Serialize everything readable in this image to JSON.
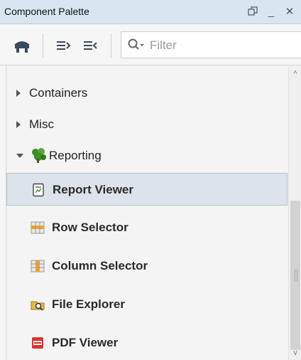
{
  "window": {
    "title": "Component Palette",
    "controls": {
      "restore_icon": "restore-icon",
      "minimize_glyph": "_",
      "close_glyph": "✕"
    }
  },
  "toolbar": {
    "tools": [
      {
        "name": "palette-mode-icon"
      },
      {
        "name": "expand-all-icon"
      },
      {
        "name": "collapse-all-icon"
      }
    ],
    "filter": {
      "placeholder": "Filter",
      "value": ""
    }
  },
  "tree": {
    "groups": [
      {
        "label": "Containers",
        "expanded": false
      },
      {
        "label": "Misc",
        "expanded": false
      },
      {
        "label": "Reporting",
        "expanded": true,
        "icon": "reporting-icon"
      }
    ],
    "reporting_items": [
      {
        "label": "Report Viewer",
        "icon": "report-viewer-icon",
        "selected": true
      },
      {
        "label": "Row Selector",
        "icon": "row-selector-icon",
        "selected": false
      },
      {
        "label": "Column Selector",
        "icon": "column-selector-icon",
        "selected": false
      },
      {
        "label": "File Explorer",
        "icon": "file-explorer-icon",
        "selected": false
      },
      {
        "label": "PDF Viewer",
        "icon": "pdf-viewer-icon",
        "selected": false
      }
    ]
  },
  "scrollbar": {
    "up_glyph": "^",
    "down_glyph": "v"
  },
  "colors": {
    "titlebar": "#d9e6f2",
    "selected_row": "#dde3ea",
    "reporting_green": "#3f8f2a",
    "pdf_red": "#d9342b"
  }
}
